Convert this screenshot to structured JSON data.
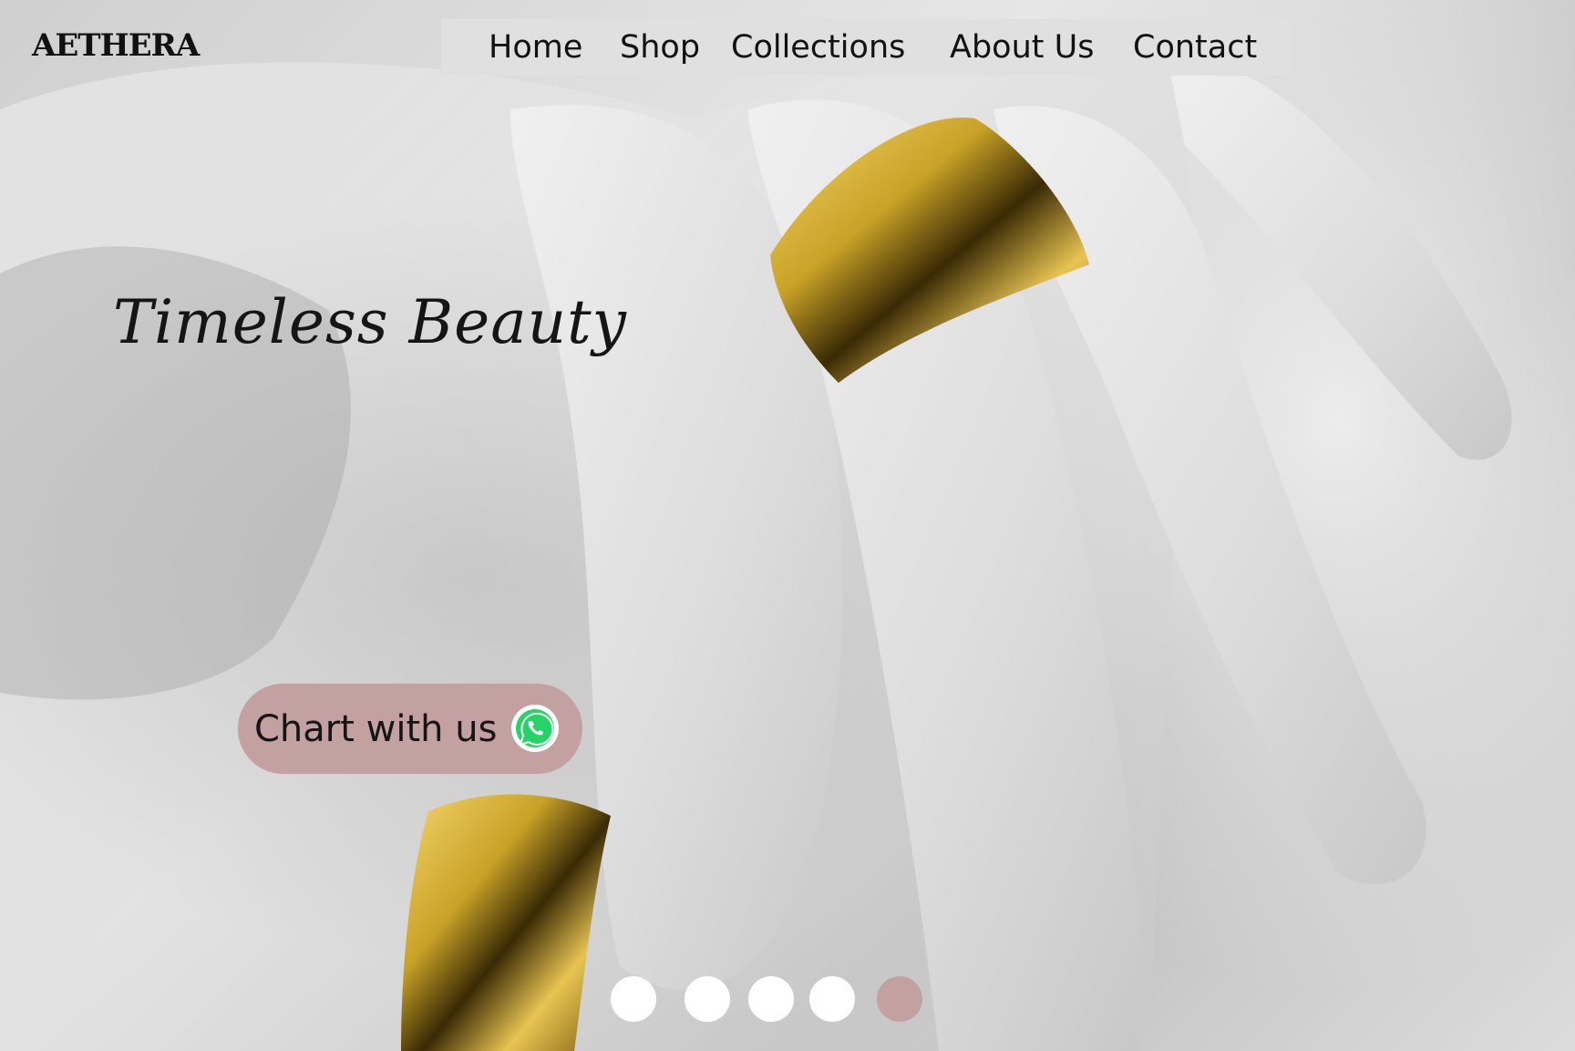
{
  "brand": {
    "logo": "AETHERA"
  },
  "nav": {
    "items": [
      {
        "label": "Home"
      },
      {
        "label": "Shop"
      },
      {
        "label": "Collections"
      },
      {
        "label": "About Us"
      },
      {
        "label": "Contact"
      }
    ]
  },
  "hero": {
    "tagline": "Timeless Beauty",
    "chat_button": {
      "label": "Chart with us",
      "icon": "whatsapp-icon"
    }
  },
  "carousel": {
    "slide_count": 5,
    "active_index": 5
  },
  "colors": {
    "accent": "#c4a1a1",
    "nav_bg": "#e0e0e0",
    "gold": "#c9a227"
  }
}
